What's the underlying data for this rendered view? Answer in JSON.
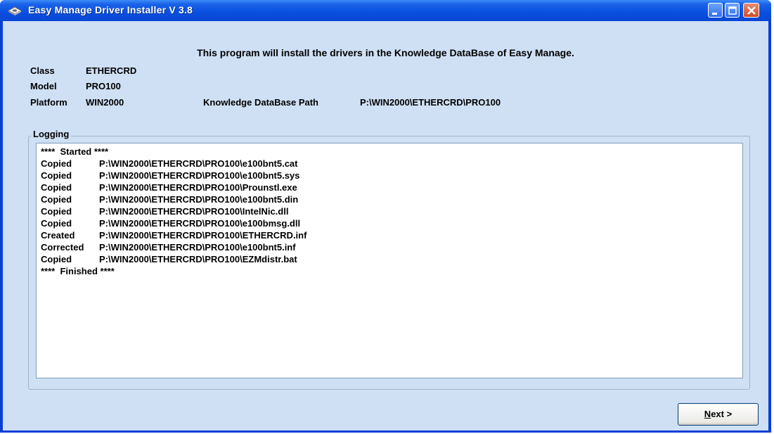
{
  "window": {
    "title": "Easy Manage Driver Installer V 3.8",
    "icon": "disk-drive-icon",
    "controls": [
      "minimize-icon",
      "maximize-icon",
      "close-icon"
    ],
    "colors": {
      "titlebar": "#0a4fe0",
      "client": "#cfe0f5",
      "close": "#d44a25"
    }
  },
  "heading": "This program will install the drivers in the Knowledge DataBase of Easy Manage.",
  "info": {
    "class_label": "Class",
    "class_value": "ETHERCRD",
    "model_label": "Model",
    "model_value": "PRO100",
    "platform_label": "Platform",
    "platform_value": "WIN2000",
    "kb_path_label": "Knowledge DataBase Path",
    "kb_path_value": "P:\\WIN2000\\ETHERCRD\\PRO100"
  },
  "logging": {
    "title": "Logging",
    "start": "****  Started ****",
    "entries": [
      {
        "action": "Copied",
        "path": "P:\\WIN2000\\ETHERCRD\\PRO100\\e100bnt5.cat"
      },
      {
        "action": "Copied",
        "path": "P:\\WIN2000\\ETHERCRD\\PRO100\\e100bnt5.sys"
      },
      {
        "action": "Copied",
        "path": "P:\\WIN2000\\ETHERCRD\\PRO100\\Prounstl.exe"
      },
      {
        "action": "Copied",
        "path": "P:\\WIN2000\\ETHERCRD\\PRO100\\e100bnt5.din"
      },
      {
        "action": "Copied",
        "path": "P:\\WIN2000\\ETHERCRD\\PRO100\\IntelNic.dll"
      },
      {
        "action": "Copied",
        "path": "P:\\WIN2000\\ETHERCRD\\PRO100\\e100bmsg.dll"
      },
      {
        "action": "Created",
        "path": "P:\\WIN2000\\ETHERCRD\\PRO100\\ETHERCRD.inf"
      },
      {
        "action": "Corrected",
        "path": "P:\\WIN2000\\ETHERCRD\\PRO100\\e100bnt5.inf"
      },
      {
        "action": "Copied",
        "path": "P:\\WIN2000\\ETHERCRD\\PRO100\\EZMdistr.bat"
      }
    ],
    "end": "****  Finished ****"
  },
  "next_button": {
    "mnemonic": "N",
    "rest": "ext >"
  }
}
